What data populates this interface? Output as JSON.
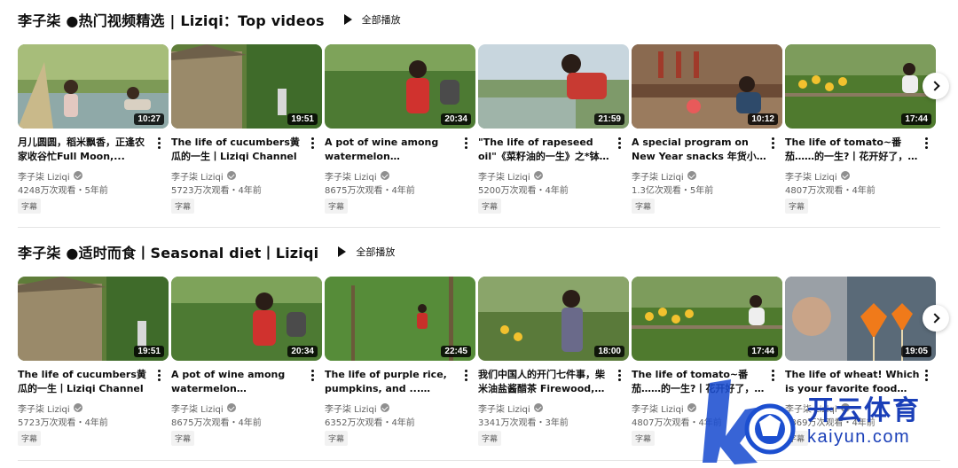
{
  "shelves": [
    {
      "title": "李子柒 ●热门视频精选 | Liziqi：Top videos",
      "play_all": "全部播放",
      "videos": [
        {
          "title": "月儿圆圆，稻米飘香，正逢农家收谷忙Full Moon,...",
          "duration": "10:27",
          "channel": "李子柒 Liziqi",
          "stats": "4248万次观看・5年前",
          "badge": "字幕"
        },
        {
          "title": "The life of cucumbers黄瓜的一生丨Liziqi Channel",
          "duration": "19:51",
          "channel": "李子柒 Liziqi",
          "stats": "5723万次观看・4年前",
          "badge": "字幕"
        },
        {
          "title": "A pot of wine among watermelon fields.So...The...",
          "duration": "20:34",
          "channel": "李子柒 Liziqi",
          "stats": "8675万次观看・4年前",
          "badge": "字幕"
        },
        {
          "title": "\"The life of rapeseed oil\"《菜籽油的一生》之*钵钵鸡,蛋...",
          "duration": "21:59",
          "channel": "李子柒 Liziqi",
          "stats": "5200万次观看・4年前",
          "badge": "字幕"
        },
        {
          "title": "A special program on New Year snacks 年货小零食特...",
          "duration": "10:12",
          "channel": "李子柒 Liziqi",
          "stats": "1.3亿次观看・5年前",
          "badge": "字幕"
        },
        {
          "title": "The life of tomato~番茄……的一生?丨花开好了，果子熟...",
          "duration": "17:44",
          "channel": "李子柒 Liziqi",
          "stats": "4807万次观看・4年前",
          "badge": "字幕"
        }
      ]
    },
    {
      "title": "李子柒 ●适时而食丨Seasonal diet丨Liziqi",
      "play_all": "全部播放",
      "videos": [
        {
          "title": "The life of cucumbers黄瓜的一生丨Liziqi Channel",
          "duration": "19:51",
          "channel": "李子柒 Liziqi",
          "stats": "5723万次观看・4年前",
          "badge": "字幕"
        },
        {
          "title": "A pot of wine among watermelon fields.So...The...",
          "duration": "20:34",
          "channel": "李子柒 Liziqi",
          "stats": "8675万次观看・4年前",
          "badge": "字幕"
        },
        {
          "title": "The life of purple rice, pumpkins, and ... peanuts紫...",
          "duration": "22:45",
          "channel": "李子柒 Liziqi",
          "stats": "6352万次观看・4年前",
          "badge": "字幕"
        },
        {
          "title": "我们中国人的开门七件事，柴米油盐酱醋茶 Firewood, rice...",
          "duration": "18:00",
          "channel": "李子柒 Liziqi",
          "stats": "3341万次观看・3年前",
          "badge": "字幕"
        },
        {
          "title": "The life of tomato~番茄……的一生?丨花开好了，果子熟...",
          "duration": "17:44",
          "channel": "李子柒 Liziqi",
          "stats": "4807万次观看・4年前",
          "badge": "字幕"
        },
        {
          "title": "The life of wheat! Which is your favorite food made fro...",
          "duration": "19:05",
          "channel": "李子柒 Liziqi",
          "stats": "3869万次观看・4年前",
          "badge": "字幕"
        }
      ]
    }
  ],
  "watermark": {
    "brand": "开云体育",
    "url": "kaiyun.com"
  },
  "colors": {
    "accent_blue": "#1a3fb8",
    "duration_bg": "#000000"
  }
}
